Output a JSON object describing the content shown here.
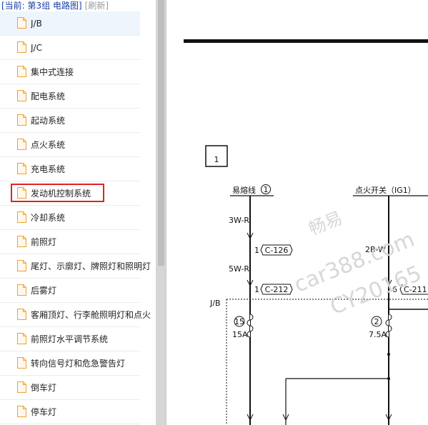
{
  "breadcrumb": {
    "current": "[当前: 第3组 电路图]",
    "refresh": "[刷新]"
  },
  "nav_items": [
    {
      "label": "J/B"
    },
    {
      "label": "J/C"
    },
    {
      "label": "集中式连接"
    },
    {
      "label": "配电系统"
    },
    {
      "label": "起动系统"
    },
    {
      "label": "点火系统"
    },
    {
      "label": "充电系统"
    },
    {
      "label": "发动机控制系统"
    },
    {
      "label": "冷却系统"
    },
    {
      "label": "前照灯"
    },
    {
      "label": "尾灯、示廓灯、牌照灯和照明灯"
    },
    {
      "label": "后雾灯"
    },
    {
      "label": "客厢顶灯、行李舱照明灯和点火"
    },
    {
      "label": "前照灯水平调节系统"
    },
    {
      "label": "转向信号灯和危急警告灯"
    },
    {
      "label": "倒车灯"
    },
    {
      "label": "停车灯"
    }
  ],
  "diagram": {
    "section_number": "1",
    "left_title": "易熔线",
    "left_circle": "1",
    "left_wire_1": "3W-R",
    "left_pin_1": "1",
    "left_conn_1": "C-126",
    "left_wire_2": "5W-R",
    "left_pin_2": "1",
    "left_conn_2": "C-212",
    "right_title": "点火开关（IG1）",
    "right_wire": "2B-W",
    "right_pin": "6",
    "right_conn": "C-211",
    "jb_label": "J/B",
    "fuse_left_num": "15",
    "fuse_left_rating": "15A",
    "fuse_right_num": "2",
    "fuse_right_rating": "7.5A"
  },
  "watermark": {
    "line1": "畅易",
    "line2": "car388.com",
    "line3": "CY20165"
  },
  "colors": {
    "highlight_border": "#e02323",
    "active_row": "#eef5fd",
    "file_icon": "#f0a030",
    "link": "#1a3fa6"
  }
}
